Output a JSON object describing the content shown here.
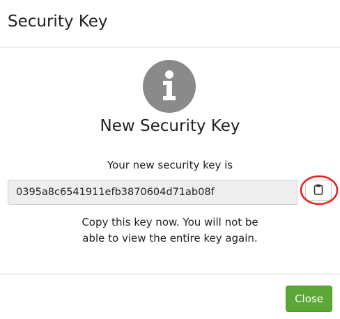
{
  "dialog": {
    "title": "Security Key",
    "heading": "New Security Key",
    "key_label": "Your new security key is",
    "key_value": "0395a8c6541911efb3870604d71ab08f",
    "warning": "Copy this key now. You will not be able to view the entire key again.",
    "info_icon": "info-circle-icon",
    "copy_icon": "clipboard-icon",
    "close_label": "Close"
  },
  "colors": {
    "info_icon_bg": "#8a8a8a",
    "close_button_bg": "#5ca836",
    "highlight_ring": "#e8221a",
    "key_field_bg": "#eeeeee"
  }
}
